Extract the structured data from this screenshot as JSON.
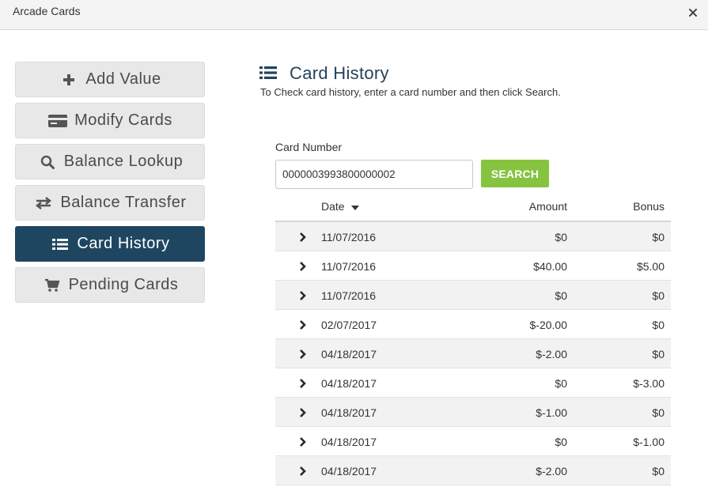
{
  "window": {
    "title": "Arcade Cards"
  },
  "sidebar": {
    "items": [
      {
        "label": "Add Value",
        "icon": "plus-icon",
        "active": false
      },
      {
        "label": "Modify Cards",
        "icon": "credit-card-icon",
        "active": false
      },
      {
        "label": "Balance Lookup",
        "icon": "search-icon",
        "active": false
      },
      {
        "label": "Balance Transfer",
        "icon": "transfer-arrows-icon",
        "active": false
      },
      {
        "label": "Card History",
        "icon": "list-icon",
        "active": true
      },
      {
        "label": "Pending Cards",
        "icon": "cart-icon",
        "active": false
      }
    ]
  },
  "main": {
    "title": "Card History",
    "title_icon": "list-icon",
    "instructions": "To Check card history, enter a card number and then click Search.",
    "card_number_label": "Card Number",
    "card_number_value": "0000003993800000002",
    "search_label": "SEARCH",
    "table": {
      "columns": {
        "date": "Date",
        "amount": "Amount",
        "bonus": "Bonus"
      },
      "sort_icon": "caret-down-icon",
      "rows": [
        {
          "date": "11/07/2016",
          "amount": "$0",
          "bonus": "$0"
        },
        {
          "date": "11/07/2016",
          "amount": "$40.00",
          "bonus": "$5.00"
        },
        {
          "date": "11/07/2016",
          "amount": "$0",
          "bonus": "$0"
        },
        {
          "date": "02/07/2017",
          "amount": "$-20.00",
          "bonus": "$0"
        },
        {
          "date": "04/18/2017",
          "amount": "$-2.00",
          "bonus": "$0"
        },
        {
          "date": "04/18/2017",
          "amount": "$0",
          "bonus": "$-3.00"
        },
        {
          "date": "04/18/2017",
          "amount": "$-1.00",
          "bonus": "$0"
        },
        {
          "date": "04/18/2017",
          "amount": "$0",
          "bonus": "$-1.00"
        },
        {
          "date": "04/18/2017",
          "amount": "$-2.00",
          "bonus": "$0"
        }
      ]
    }
  },
  "colors": {
    "accent_dark": "#1f4660",
    "search_green": "#86c440",
    "title_blue": "#24425a"
  }
}
